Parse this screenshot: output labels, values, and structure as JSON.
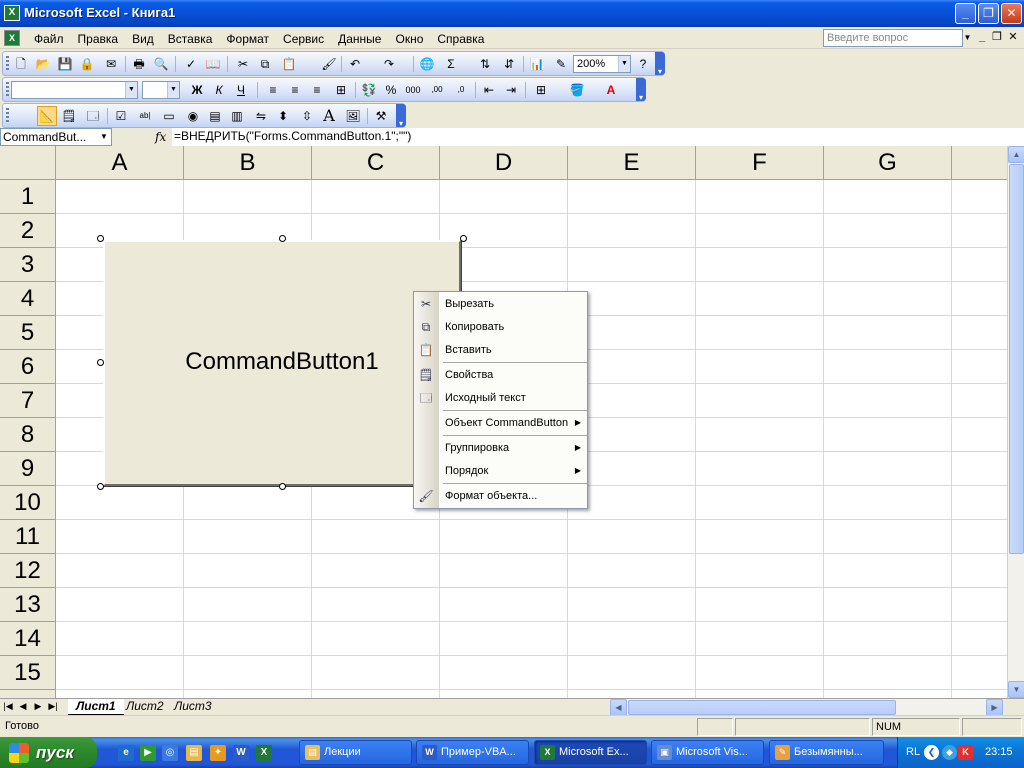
{
  "window": {
    "title": "Microsoft Excel - Книга1",
    "minimize_icon": "minimize-icon",
    "maximize_icon": "restore-icon",
    "close_icon": "close-icon"
  },
  "menubar": {
    "items": [
      {
        "label": "Файл"
      },
      {
        "label": "Правка"
      },
      {
        "label": "Вид"
      },
      {
        "label": "Вставка"
      },
      {
        "label": "Формат"
      },
      {
        "label": "Сервис"
      },
      {
        "label": "Данные"
      },
      {
        "label": "Окно"
      },
      {
        "label": "Справка"
      }
    ],
    "help_placeholder": "Введите вопрос"
  },
  "standard_toolbar": {
    "zoom": "200%"
  },
  "formula_bar": {
    "name_box": "CommandBut...",
    "fx_label": "fx",
    "formula": "=ВНЕДРИТЬ(\"Forms.CommandButton.1\";\"\")"
  },
  "grid": {
    "columns": [
      "A",
      "B",
      "C",
      "D",
      "E",
      "F",
      "G"
    ],
    "rows": [
      "1",
      "2",
      "3",
      "4",
      "5",
      "6",
      "7",
      "8",
      "9",
      "10",
      "11",
      "12",
      "13",
      "14",
      "15"
    ]
  },
  "command_button": {
    "caption": "CommandButton1"
  },
  "context_menu": {
    "items": [
      {
        "label": "Вырезать",
        "icon": "scissors-icon"
      },
      {
        "label": "Копировать",
        "icon": "copy-icon"
      },
      {
        "label": "Вставить",
        "icon": "paste-icon"
      },
      {
        "label": "Свойства",
        "icon": "properties-icon"
      },
      {
        "label": "Исходный текст",
        "icon": "view-code-icon"
      },
      {
        "label": "Объект CommandButton",
        "submenu": true
      },
      {
        "label": "Группировка",
        "submenu": true
      },
      {
        "label": "Порядок",
        "submenu": true
      },
      {
        "label": "Формат объекта...",
        "icon": "format-object-icon"
      }
    ]
  },
  "sheets": {
    "tabs": [
      {
        "label": "Лист1",
        "active": true
      },
      {
        "label": "Лист2",
        "active": false
      },
      {
        "label": "Лист3",
        "active": false
      }
    ]
  },
  "statusbar": {
    "status": "Готово",
    "num": "NUM"
  },
  "taskbar": {
    "start_label": "пуск",
    "tasks": [
      {
        "label": "Лекции",
        "active": false
      },
      {
        "label": "Пример-VBA...",
        "active": false
      },
      {
        "label": "Microsoft Ex...",
        "active": true
      },
      {
        "label": "Microsoft Vis...",
        "active": false
      },
      {
        "label": "Безымянны...",
        "active": false
      }
    ],
    "language": "RL",
    "clock": "23:15"
  },
  "colors": {
    "title_bar": "#0a5ce6",
    "taskbar": "#2157d7",
    "start_button": "#2e8b2e",
    "face": "#ece9d8"
  }
}
